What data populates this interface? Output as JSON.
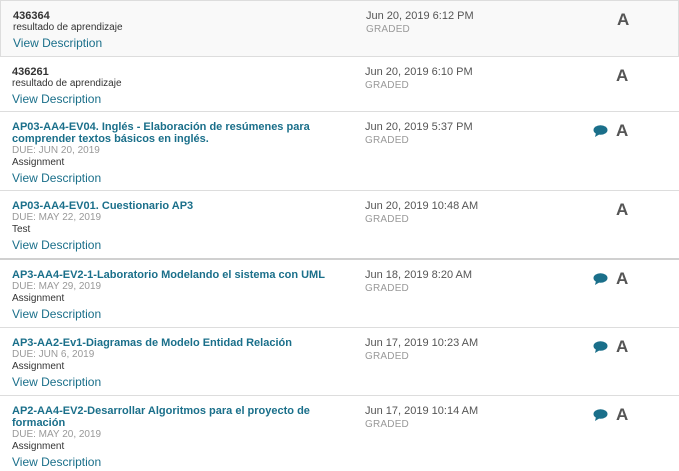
{
  "view_description_label": "View Description",
  "items": [
    {
      "title": "436364",
      "title_is_link": false,
      "due": "",
      "type": "resultado de aprendizaje",
      "date": "Jun 20, 2019 6:12 PM",
      "status": "GRADED",
      "grade": "A",
      "has_comment": false
    },
    {
      "title": "436261",
      "title_is_link": false,
      "due": "",
      "type": "resultado de aprendizaje",
      "date": "Jun 20, 2019 6:10 PM",
      "status": "GRADED",
      "grade": "A",
      "has_comment": false
    },
    {
      "title": "AP03-AA4-EV04. Inglés - Elaboración de resúmenes para comprender textos básicos en inglés.",
      "title_is_link": true,
      "due": "DUE: JUN 20, 2019",
      "type": "Assignment",
      "date": "Jun 20, 2019 5:37 PM",
      "status": "GRADED",
      "grade": "A",
      "has_comment": true
    },
    {
      "title": "AP03-AA4-EV01. Cuestionario AP3",
      "title_is_link": true,
      "due": "DUE: MAY 22, 2019",
      "type": "Test",
      "date": "Jun 20, 2019 10:48 AM",
      "status": "GRADED",
      "grade": "A",
      "has_comment": false
    },
    {
      "title": "AP3-AA4-EV2-1-Laboratorio Modelando el sistema con UML",
      "title_is_link": true,
      "due": "DUE: MAY 29, 2019",
      "type": "Assignment",
      "date": "Jun 18, 2019 8:20 AM",
      "status": "GRADED",
      "grade": "A",
      "has_comment": true
    },
    {
      "title": "AP3-AA2-Ev1-Diagramas de Modelo Entidad Relación",
      "title_is_link": true,
      "due": "DUE: JUN 6, 2019",
      "type": "Assignment",
      "date": "Jun 17, 2019 10:23 AM",
      "status": "GRADED",
      "grade": "A",
      "has_comment": true
    },
    {
      "title": "AP2-AA4-EV2-Desarrollar Algoritmos para el proyecto de formación",
      "title_is_link": true,
      "due": "DUE: MAY 20, 2019",
      "type": "Assignment",
      "date": "Jun 17, 2019 10:14 AM",
      "status": "GRADED",
      "grade": "A",
      "has_comment": true
    }
  ]
}
